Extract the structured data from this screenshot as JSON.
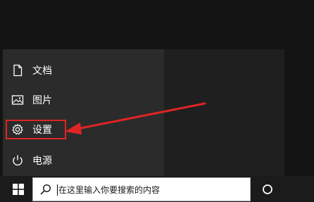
{
  "start_menu": {
    "items": [
      {
        "label": "文档",
        "icon": "document-icon"
      },
      {
        "label": "图片",
        "icon": "pictures-icon"
      },
      {
        "label": "设置",
        "icon": "gear-icon"
      },
      {
        "label": "电源",
        "icon": "power-icon"
      }
    ]
  },
  "taskbar": {
    "search_placeholder": "在这里输入你要搜索的内容"
  },
  "annotation": {
    "highlight_color": "#e02424",
    "target": "设置"
  }
}
